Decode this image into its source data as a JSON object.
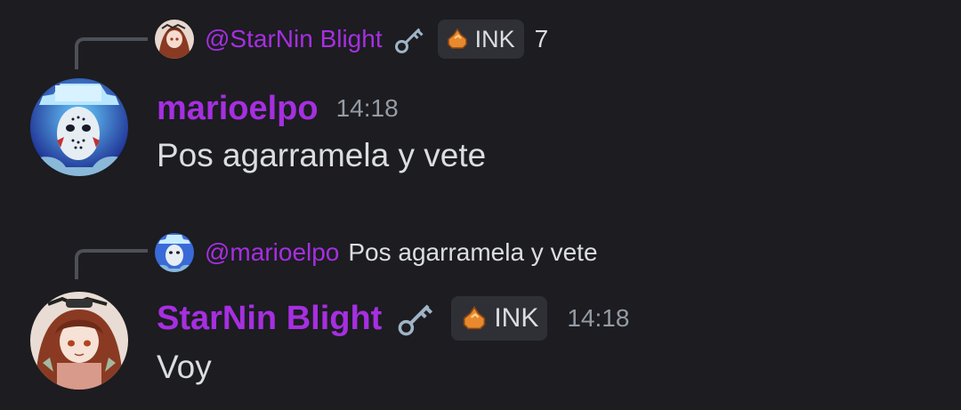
{
  "messages": [
    {
      "reply": {
        "author": "@StarNin Blight",
        "tag": "INK",
        "tag_count": "7",
        "key_icon": "key-icon",
        "tag_icon": "ink-blob-icon"
      },
      "author": "marioelpo",
      "time": "14:18",
      "text": "Pos agarramela y vete",
      "avatar": "hockey-mask-avatar"
    },
    {
      "reply": {
        "author": "@marioelpo",
        "text": "Pos agarramela y vete"
      },
      "author": "StarNin Blight",
      "tag": "INK",
      "time": "14:18",
      "text": "Voy",
      "avatar": "anime-girl-avatar",
      "key_icon": "key-icon",
      "tag_icon": "ink-blob-icon"
    }
  ],
  "colors": {
    "background": "#1c1c21",
    "username": "#a62fe0",
    "text": "#dbdee1",
    "timestamp": "#949ba4",
    "tag_bg": "#2e3036",
    "spine": "#4e5058"
  }
}
